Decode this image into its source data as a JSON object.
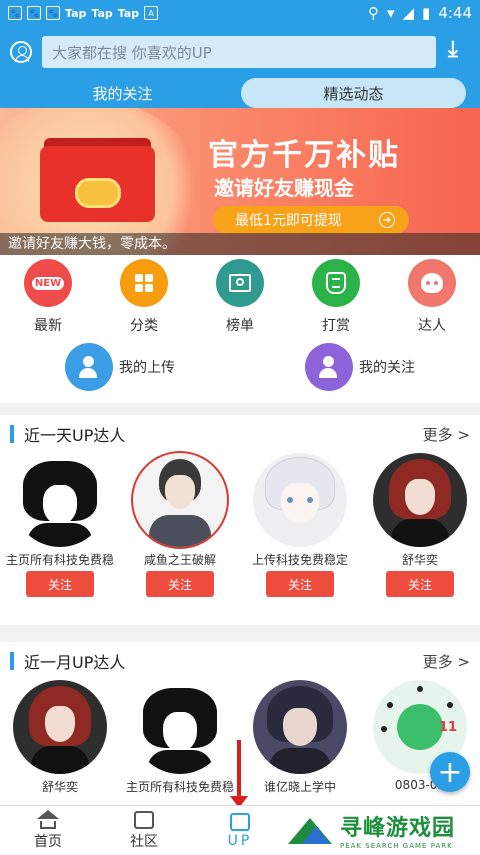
{
  "status_bar": {
    "tap1": "Tap",
    "tap2": "Tap",
    "tap3": "Tap",
    "time": "4:44"
  },
  "header": {
    "search_placeholder": "大家都在搜  你喜欢的UP",
    "tabs": [
      {
        "label": "我的关注",
        "active": true
      },
      {
        "label": "精选动态",
        "active": false
      }
    ]
  },
  "banner": {
    "title": "官方千万补贴",
    "subtitle": "邀请好友赚现金",
    "button_label": "最低1元即可提现",
    "caption": "邀请好友赚大钱，零成本。"
  },
  "menu": {
    "row1": [
      {
        "label": "最新",
        "icon": "new-icon",
        "color": "#f04b4b",
        "badge": "NEW"
      },
      {
        "label": "分类",
        "icon": "grid-icon",
        "color": "#f79d0e"
      },
      {
        "label": "榜单",
        "icon": "certificate-icon",
        "color": "#2f9a8f"
      },
      {
        "label": "打赏",
        "icon": "money-bag-icon",
        "color": "#2bb34a"
      },
      {
        "label": "达人",
        "icon": "expert-icon",
        "color": "#f1776c"
      }
    ],
    "row2": [
      {
        "label": "我的上传",
        "icon": "upload-user-icon",
        "color": "#3a9de6"
      },
      {
        "label": "我的关注",
        "icon": "follow-user-icon",
        "color": "#8c63d9"
      }
    ]
  },
  "section_day": {
    "title": "近一天UP达人",
    "more": "更多 >",
    "users": [
      {
        "name": "主页所有科技免费稳",
        "follow": "关注"
      },
      {
        "name": "咸鱼之王破解",
        "follow": "关注"
      },
      {
        "name": "上传科技免费稳定",
        "follow": "关注"
      },
      {
        "name": "舒华奕",
        "follow": "关注"
      }
    ]
  },
  "section_month": {
    "title": "近一月UP达人",
    "more": "更多 >",
    "users": [
      {
        "name": "舒华奕"
      },
      {
        "name": "主页所有科技免费稳"
      },
      {
        "name": "谁亿晓上学中"
      },
      {
        "name": "0803-02"
      }
    ]
  },
  "bottom_nav": [
    {
      "label": "首页",
      "icon": "home-icon"
    },
    {
      "label": "社区",
      "icon": "community-icon"
    },
    {
      "label": "UP",
      "icon": "up-icon",
      "active": true
    }
  ],
  "watermark": {
    "cn": "寻峰游戏园",
    "en": "PEAK SEARCH GAME PARK"
  },
  "colors": {
    "primary": "#2b9fe6",
    "follow_button": "#ee4c3e"
  }
}
